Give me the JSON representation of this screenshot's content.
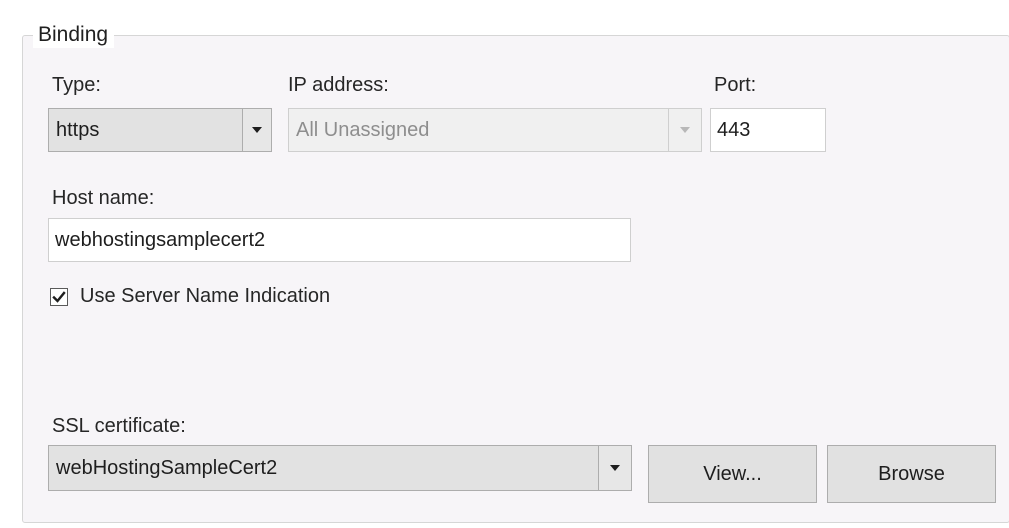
{
  "group": {
    "title": "Binding"
  },
  "type": {
    "label": "Type:",
    "value": "https"
  },
  "ip_address": {
    "label": "IP address:",
    "value": "All Unassigned",
    "disabled": true
  },
  "port": {
    "label": "Port:",
    "value": "443"
  },
  "host_name": {
    "label": "Host name:",
    "value": "webhostingsamplecert2"
  },
  "sni": {
    "label": "Use Server Name Indication",
    "checked": true
  },
  "ssl_certificate": {
    "label": "SSL certificate:",
    "value": "webHostingSampleCert2"
  },
  "buttons": {
    "view_label": "View...",
    "browse_label": "Browse"
  },
  "icons": {
    "dropdown": "chevron-down-icon",
    "check": "checkmark-icon"
  },
  "colors": {
    "panel_background": "#f7f5f8",
    "control_background": "#e2e2e2",
    "disabled_text": "#8e8e8e"
  }
}
